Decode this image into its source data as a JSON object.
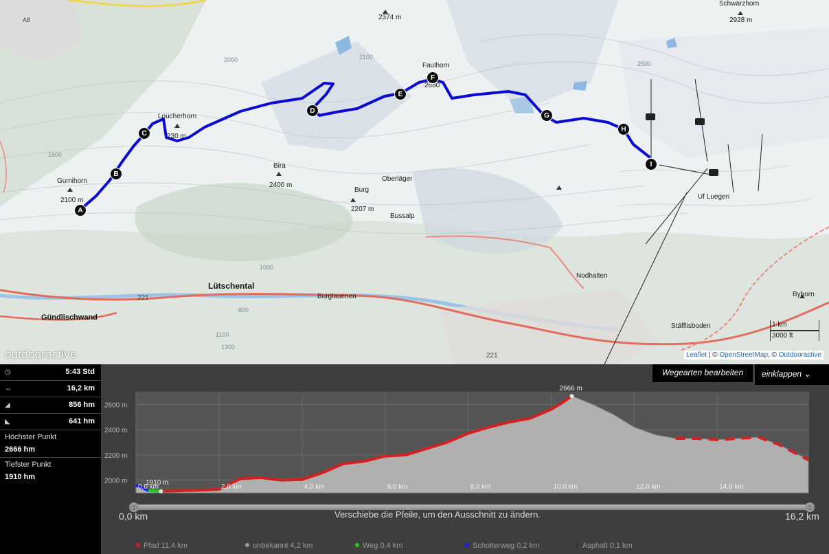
{
  "map": {
    "brand": "outdooractive",
    "attribution": {
      "leaflet": "Leaflet",
      "sep": "|",
      "osm_prefix": "©",
      "osm": "OpenStreetMap",
      "oa_prefix": ", ©",
      "oa": "Outdooractive"
    },
    "scale": {
      "metric": "1 km",
      "imperial": "3000 ft"
    },
    "waypoints": [
      "A",
      "B",
      "C",
      "D",
      "E",
      "F",
      "G",
      "H",
      "I"
    ],
    "labels": {
      "peak_2374": "2374 m",
      "schwarzhorn": "Schwarzhorn",
      "schwarzhorn_alt": "2928 m",
      "faulhorn": "Faulhorn",
      "faulhorn_alt": "2680",
      "loucherhorn": "Loucherhorn",
      "loucherhorn_alt": "230 m",
      "gumihorn": "Gumihorn",
      "gumihorn_alt": "2100 m",
      "bira": "Bira",
      "bira_alt": "2400 m",
      "oberlager": "Oberläger",
      "burg": "Burg",
      "burg_alt": "2207 m",
      "bussalp": "Bussalp",
      "uf_luegen": "Uf Luegen",
      "nodhalten": "Nodhalten",
      "lutschental": "Lütschental",
      "burglauenen": "Burglauenen",
      "gundlischwand": "Gündlischwand",
      "byhorn": "Byhorn",
      "stallisboden": "Stäfflisboden",
      "road_221a": "221",
      "road_221b": "221",
      "road_a8": "A8",
      "c1600": "1600",
      "c2000": "2000",
      "c2100": "2100",
      "c2500": "2500",
      "c1000": "1000",
      "c800": "800",
      "c1100": "1100",
      "c1300": "1300"
    }
  },
  "stats": {
    "duration": "5:43 Std",
    "distance": "16,2 km",
    "ascent": "856 hm",
    "descent": "641 hm",
    "highest_label": "Höchster Punkt",
    "highest_value": "2666 hm",
    "lowest_label": "Tiefster Punkt",
    "lowest_value": "1910 hm"
  },
  "profile": {
    "edit_button": "Wegearten bearbeiten",
    "collapse_button": "einklappen",
    "peak_label": "2666 m",
    "start_label": "1910 m",
    "y_ticks": [
      "2600 m",
      "2400 m",
      "2200 m",
      "2000 m"
    ],
    "x_ticks": [
      "0,0 km",
      "2,0 km",
      "4,0 km",
      "6,0 km",
      "8,0 km",
      "10,0 km",
      "12,0 km",
      "14,0 km"
    ],
    "range_start": "0,0 km",
    "range_end": "16,2 km",
    "range_hint": "Verschiebe die Pfeile, um den Ausschnitt zu ändern."
  },
  "legend": [
    {
      "label": "Pfad 11,4 km",
      "color": "#d42020"
    },
    {
      "label": "unbekannt 4,2 km",
      "color": "#9a9a9a"
    },
    {
      "label": "Weg 0,4 km",
      "color": "#22cc22"
    },
    {
      "label": "Schotterweg 0,2 km",
      "color": "#1a1ae6"
    },
    {
      "label": "Asphalt 0,1 km",
      "color": "#333333"
    }
  ],
  "chart_data": {
    "type": "area",
    "xlabel": "",
    "ylabel": "",
    "xlim": [
      0,
      16.2
    ],
    "ylim": [
      1900,
      2700
    ],
    "x": [
      0,
      0.3,
      0.6,
      1,
      1.5,
      2,
      2.5,
      3,
      3.5,
      4,
      4.5,
      5,
      5.5,
      6,
      6.5,
      7,
      7.5,
      8,
      8.5,
      9,
      9.5,
      10,
      10.3,
      10.5,
      11,
      11.5,
      12,
      12.5,
      13,
      13.5,
      14,
      14.5,
      15,
      15.5,
      16.2
    ],
    "series": [
      {
        "values": [
          1960,
          1918,
          1912,
          1915,
          1920,
          1928,
          2010,
          2020,
          2000,
          2005,
          2060,
          2130,
          2150,
          2190,
          2200,
          2250,
          2300,
          2370,
          2420,
          2460,
          2490,
          2560,
          2620,
          2666,
          2600,
          2520,
          2420,
          2360,
          2330,
          2330,
          2320,
          2330,
          2340,
          2280,
          2160
        ]
      }
    ]
  }
}
